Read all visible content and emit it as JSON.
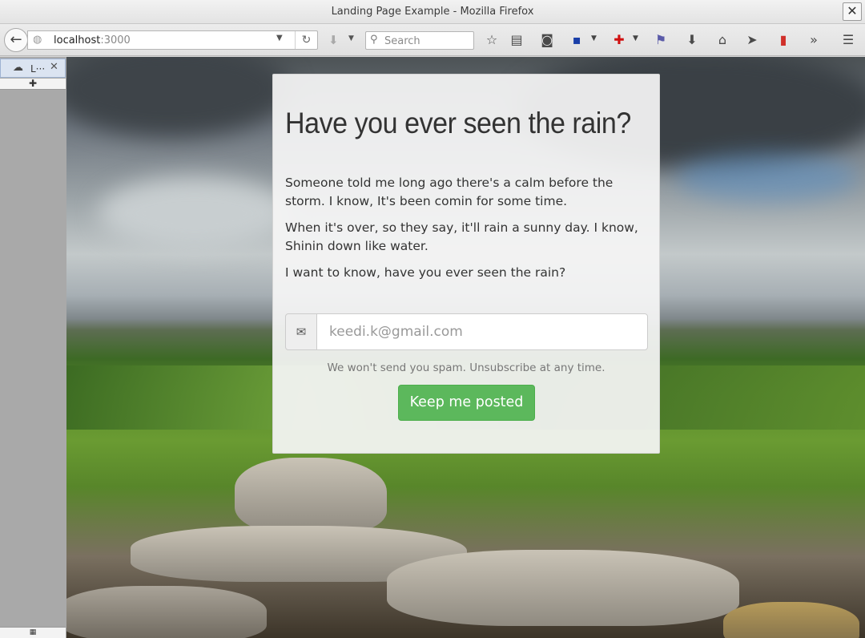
{
  "window": {
    "title": "Landing Page Example - Mozilla Firefox",
    "close_glyph": "✕"
  },
  "toolbar": {
    "url_host": "localhost",
    "url_port": ":3000",
    "search_placeholder": "Search",
    "icons": [
      "back-icon",
      "globe-icon",
      "reload-icon",
      "download-icon",
      "search-icon",
      "bookmark-star-icon",
      "reading-list-icon",
      "pocket-icon",
      "save-icon",
      "addon-red-cross-icon",
      "addon-icon",
      "downloads-arrow-icon",
      "home-icon",
      "send-icon",
      "addon-battery-icon",
      "overflow-chevrons-icon",
      "menu-hamburger-icon"
    ]
  },
  "sidebar": {
    "tab_label": "L···",
    "new_tab_glyph": "✚"
  },
  "card": {
    "heading": "Have you ever seen the rain?",
    "paragraphs": [
      "Someone told me long ago there's a calm before the storm. I know, It's been comin for some time.",
      "When it's over, so they say, it'll rain a sunny day. I know, Shinin down like water.",
      "I want to know, have you ever seen the rain?"
    ],
    "email_placeholder": "keedi.k@gmail.com",
    "note": "We won't send you spam. Unsubscribe at any time.",
    "button_label": "Keep me posted"
  }
}
